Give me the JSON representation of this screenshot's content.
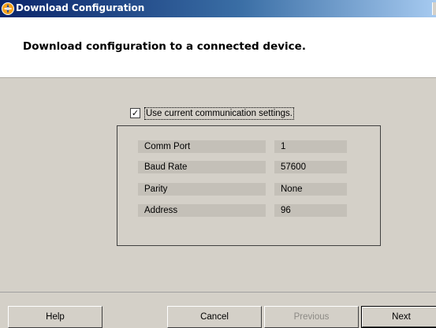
{
  "window": {
    "title": "Download Configuration",
    "icon": "app-logo-icon"
  },
  "header": {
    "subtitle": "Download configuration to a connected device."
  },
  "options": {
    "use_current_settings": {
      "label": "Use current communication settings.",
      "checked": true,
      "check_mark": "✓"
    }
  },
  "settings": [
    {
      "label": "Comm Port",
      "value": "1"
    },
    {
      "label": "Baud Rate",
      "value": "57600"
    },
    {
      "label": "Parity",
      "value": "None"
    },
    {
      "label": "Address",
      "value": "96"
    }
  ],
  "buttons": {
    "help": "Help",
    "cancel": "Cancel",
    "previous": "Previous",
    "next": "Next"
  }
}
